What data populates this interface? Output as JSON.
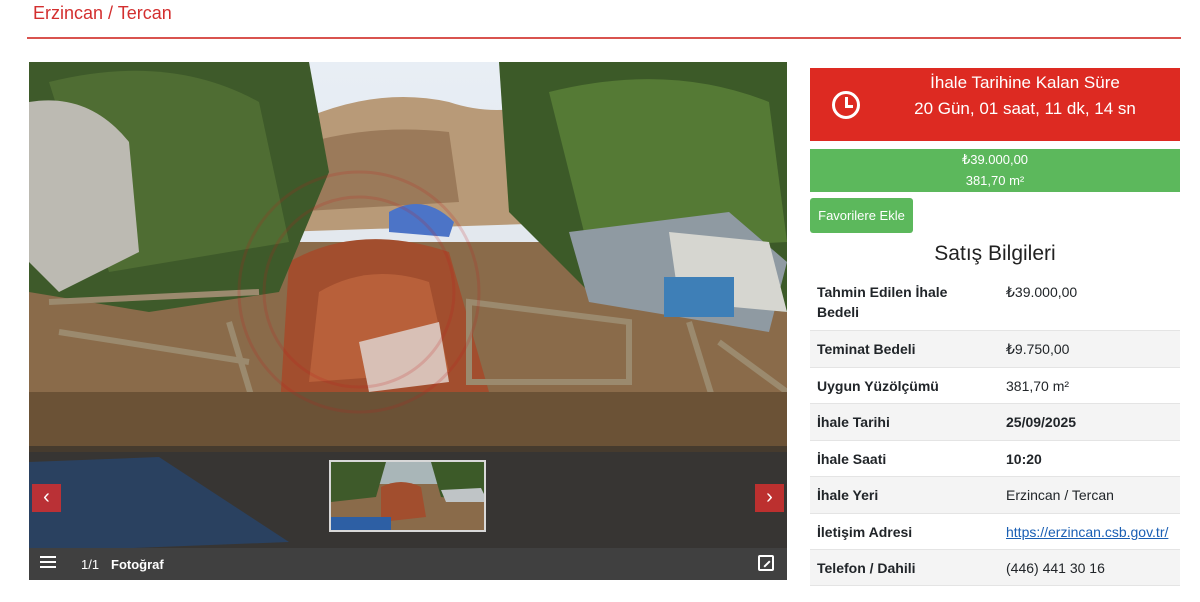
{
  "page": {
    "title": "Erzincan / Tercan"
  },
  "gallery": {
    "counter": "1/1",
    "label": "Fotoğraf",
    "prev_icon": "chevron-left-icon",
    "next_icon": "chevron-right-icon"
  },
  "countdown": {
    "title": "İhale Tarihine Kalan Süre",
    "time": "20 Gün, 01 saat, 11 dk, 14 sn",
    "icon": "clock-icon",
    "color": "#dd2a22"
  },
  "price": {
    "amount": "₺39.000,00",
    "area": "381,70 m²",
    "color": "#5cb85c"
  },
  "favorite_button": "Favorilere Ekle",
  "sale_info": {
    "title": "Satış Bilgileri",
    "rows": [
      {
        "key": "Tahmin Edilen İhale Bedeli",
        "value": "₺39.000,00"
      },
      {
        "key": "Teminat Bedeli",
        "value": "₺9.750,00"
      },
      {
        "key": "Uygun Yüzölçümü",
        "value": "381,70 m²"
      },
      {
        "key": "İhale Tarihi",
        "value": "25/09/2025"
      },
      {
        "key": "İhale Saati",
        "value": "10:20"
      },
      {
        "key": "İhale Yeri",
        "value": "Erzincan / Tercan"
      },
      {
        "key": "İletişim Adresi",
        "value": "https://erzincan.csb.gov.tr/"
      },
      {
        "key": "Telefon / Dahili",
        "value": "(446) 441 30 16"
      }
    ]
  }
}
